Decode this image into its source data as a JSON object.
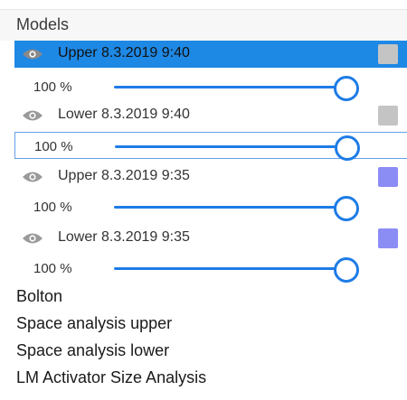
{
  "panel": {
    "title": "Models"
  },
  "models": [
    {
      "label": "Upper 8.3.2019 9:40",
      "opacity": "100 %",
      "opacity_value": 1.0,
      "swatch_color": "#c4c4c4",
      "visible_icon": "eye-icon",
      "selected": true
    },
    {
      "label": "Lower 8.3.2019 9:40",
      "opacity": "100 %",
      "opacity_value": 1.0,
      "swatch_color": "#c4c4c4",
      "visible_icon": "eye-icon",
      "selected": false
    },
    {
      "label": "Upper 8.3.2019 9:35",
      "opacity": "100 %",
      "opacity_value": 1.0,
      "swatch_color": "#8c8cf5",
      "visible_icon": "eye-icon",
      "selected": false
    },
    {
      "label": "Lower 8.3.2019 9:35",
      "opacity": "100 %",
      "opacity_value": 1.0,
      "swatch_color": "#8c8cf5",
      "visible_icon": "eye-icon",
      "selected": false
    }
  ],
  "analyses": [
    "Bolton",
    "Space analysis upper",
    "Space analysis lower",
    "LM Activator Size Analysis"
  ],
  "colors": {
    "accent": "#1e88e5",
    "slider": "#1e7ce6",
    "eye": "#9a9a9a"
  }
}
